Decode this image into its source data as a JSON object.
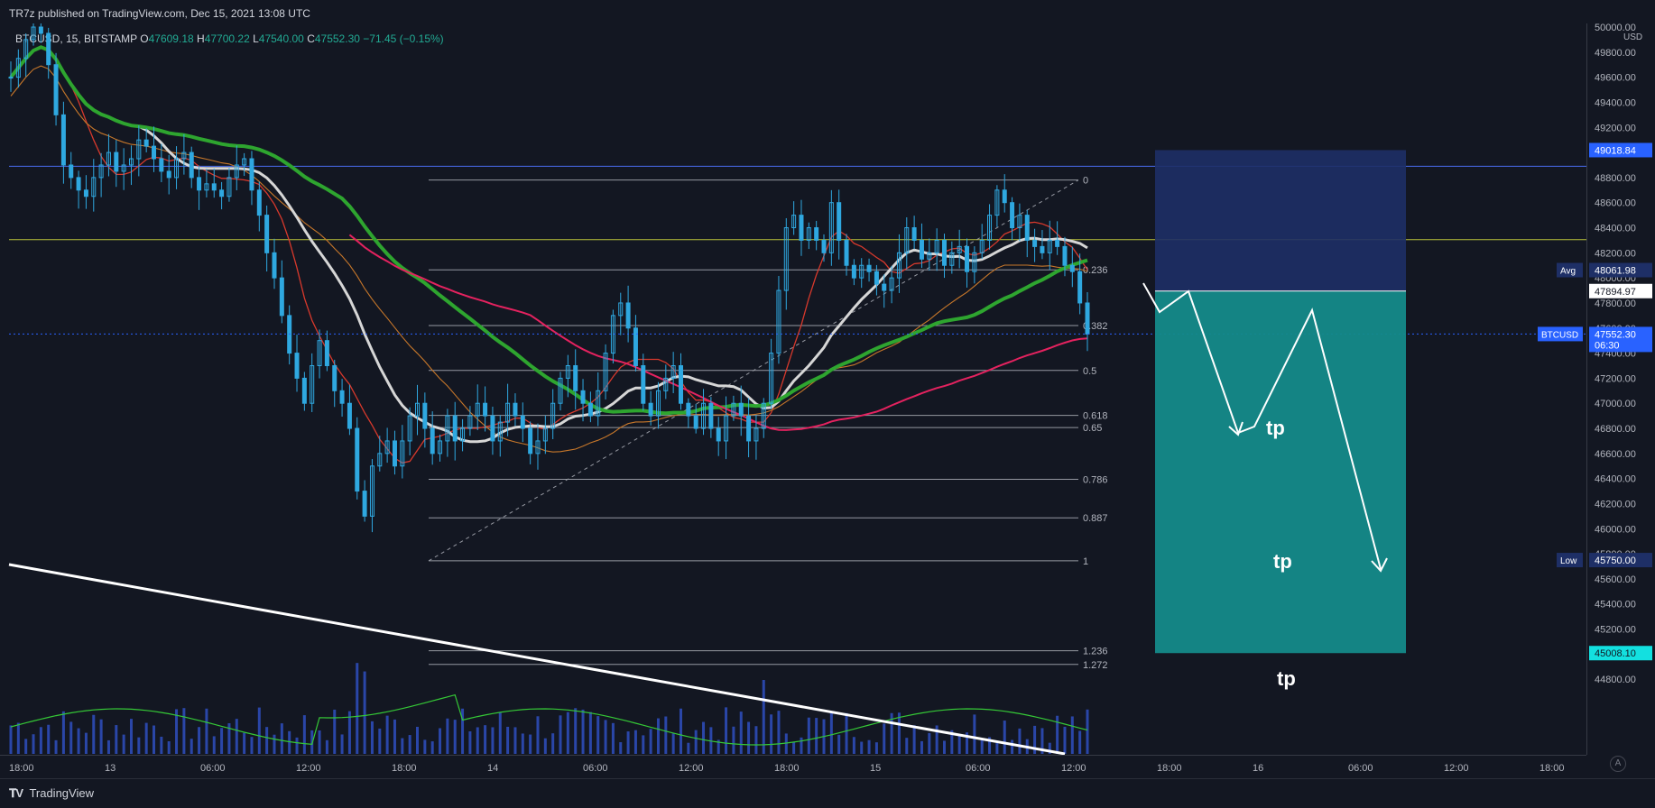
{
  "header": {
    "publisher_line": "TR7z published on TradingView.com, Dec 15, 2021 13:08 UTC"
  },
  "ohlc": {
    "symbol": "BTCUSD, 15, BITSTAMP",
    "open_label": "O",
    "open": "47609.18",
    "high_label": "H",
    "high": "47700.22",
    "low_label": "L",
    "low": "47540.00",
    "close_label": "C",
    "close": "47552.30",
    "change": "−71.45 (−0.15%)"
  },
  "footer": {
    "logo_text": "TradingView",
    "axis_mode": "A"
  },
  "colors": {
    "background": "#131722",
    "candle": "#2fa8e0",
    "volume": "#2f4fbf",
    "ma_white": "#d6d6d6",
    "ma_green": "#2ea52f",
    "ma_red": "#d8392c",
    "ma_orange": "#c7772a",
    "ma_pink": "#e4225f",
    "vol_ma": "#35c936",
    "stop_zone": "#1e2f66",
    "target_zone": "#148a8a",
    "price_label": "#2962ff"
  },
  "chart_data": {
    "type": "candlestick",
    "symbol": "BTCUSD",
    "interval": "15",
    "exchange": "BITSTAMP",
    "currency": "USD",
    "ylim": [
      44600,
      50000
    ],
    "y_ticks": [
      44800,
      45000,
      45200,
      45400,
      45600,
      45800,
      46000,
      46200,
      46400,
      46600,
      46800,
      47000,
      47200,
      47400,
      47600,
      47800,
      48000,
      48200,
      48400,
      48600,
      48800,
      49000,
      49200,
      49400,
      49600,
      49800,
      50000
    ],
    "x_ticks": [
      "18:00",
      "13",
      "06:00",
      "12:00",
      "18:00",
      "14",
      "06:00",
      "12:00",
      "18:00",
      "15",
      "06:00",
      "12:00",
      "18:00",
      "16",
      "06:00",
      "12:00",
      "18:00"
    ],
    "price_labels": [
      {
        "text": "49018.84",
        "price": 49018.84,
        "color": "#2962ff"
      },
      {
        "text": "48061.98",
        "price": 48061.98,
        "tag": "Avg",
        "color": "#1e2f66"
      },
      {
        "text": "47894.97",
        "price": 47894.97,
        "color": "#ffffff"
      },
      {
        "text": "47552.30",
        "price": 47552.3,
        "tag": "BTCUSD",
        "sub": "06:30",
        "color": "#2962ff"
      },
      {
        "text": "45750.00",
        "price": 45750.0,
        "tag": "Low",
        "color": "#1e2f66"
      },
      {
        "text": "45008.10",
        "price": 45008.1,
        "color": "#13e0e0"
      }
    ],
    "horizontal_lines": [
      {
        "price": 48890,
        "color": "#4a6cf0"
      },
      {
        "price": 48305,
        "color": "#b9c23a"
      }
    ],
    "fibonacci": {
      "levels": [
        {
          "label": "0",
          "price": 48780
        },
        {
          "label": "0.236",
          "price": 48064
        },
        {
          "label": "0.382",
          "price": 47620
        },
        {
          "label": "0.5",
          "price": 47262
        },
        {
          "label": "0.618",
          "price": 46904
        },
        {
          "label": "0.65",
          "price": 46807
        },
        {
          "label": "0.786",
          "price": 46394
        },
        {
          "label": "0.887",
          "price": 46087
        },
        {
          "label": "1",
          "price": 45744
        },
        {
          "label": "1.236",
          "price": 45027
        },
        {
          "label": "1.272",
          "price": 44918
        }
      ]
    },
    "position": {
      "entry": 47894.97,
      "stop": 49018.84,
      "target": 45008.1,
      "tp_labels": [
        "tp",
        "tp",
        "tp"
      ]
    },
    "candles_close": [
      49600,
      49750,
      49900,
      50000,
      49950,
      49700,
      49300,
      48900,
      48800,
      48700,
      48650,
      48800,
      48900,
      49000,
      48850,
      48900,
      48950,
      49100,
      49050,
      48950,
      48850,
      48800,
      48950,
      49000,
      48800,
      48700,
      48750,
      48700,
      48650,
      48800,
      48900,
      48950,
      48700,
      48500,
      48200,
      48000,
      47700,
      47400,
      47200,
      47000,
      47300,
      47500,
      47300,
      47100,
      47000,
      46800,
      46300,
      46100,
      46500,
      46600,
      46700,
      46500,
      46700,
      46900,
      47000,
      46800,
      46600,
      46700,
      46900,
      46700,
      46800,
      46900,
      47000,
      46900,
      46700,
      46850,
      47000,
      46900,
      46800,
      46600,
      46700,
      46800,
      47000,
      47200,
      47300,
      47100,
      47000,
      46900,
      47100,
      47400,
      47700,
      47800,
      47600,
      47300,
      47000,
      46900,
      47100,
      47200,
      47300,
      47000,
      46900,
      46800,
      47000,
      46800,
      46700,
      46900,
      47000,
      46900,
      46700,
      46800,
      47000,
      47400,
      47900,
      48400,
      48500,
      48300,
      48400,
      48300,
      48200,
      48600,
      48300,
      48100,
      48000,
      48100,
      48050,
      47950,
      47900,
      48000,
      48200,
      48400,
      48300,
      48150,
      48200,
      48300,
      48100,
      48200,
      48250,
      48050,
      48200,
      48300,
      48500,
      48700,
      48600,
      48400,
      48500,
      48300,
      48250,
      48200,
      48300,
      48250,
      48100,
      48050,
      47800,
      47552
    ],
    "moving_averages": [
      {
        "name": "MA white",
        "color": "#d6d6d6"
      },
      {
        "name": "MA green",
        "color": "#2ea52f"
      },
      {
        "name": "MA red",
        "color": "#d8392c"
      },
      {
        "name": "MA orange",
        "color": "#c7772a"
      },
      {
        "name": "MA pink",
        "color": "#e4225f"
      }
    ]
  }
}
